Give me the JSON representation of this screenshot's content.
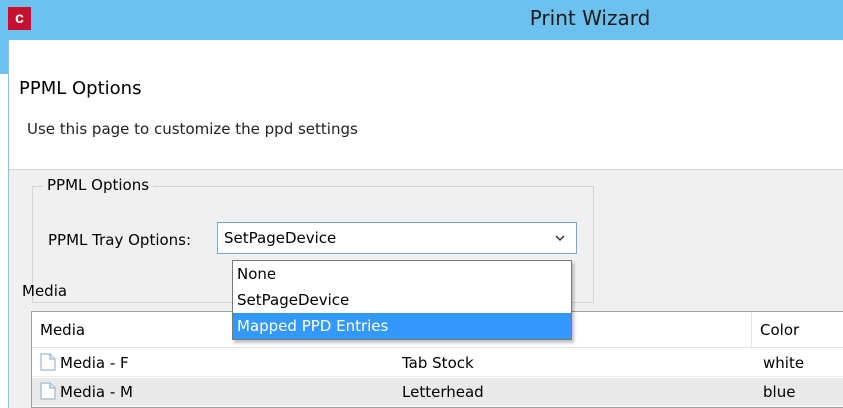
{
  "window": {
    "title": "Print Wizard",
    "app_icon_letter": "c"
  },
  "header": {
    "title": "PPML Options",
    "subtitle": "Use this page to customize the ppd settings"
  },
  "ppml_group": {
    "legend": "PPML Options",
    "tray_label": "PPML Tray Options:",
    "tray_value": "SetPageDevice",
    "options": [
      "None",
      "SetPageDevice",
      "Mapped PPD Entries"
    ],
    "highlighted_option": "Mapped PPD Entries"
  },
  "media": {
    "label": "Media",
    "columns": [
      "Media",
      "Color"
    ],
    "rows": [
      {
        "name": "Media - F",
        "type": "Tab Stock",
        "color": "white"
      },
      {
        "name": "Media - M",
        "type": "Letterhead",
        "color": "blue"
      }
    ]
  },
  "colors": {
    "titlebar": "#6cc1ef",
    "selection": "#3399ff",
    "app_icon": "#c8102e"
  }
}
